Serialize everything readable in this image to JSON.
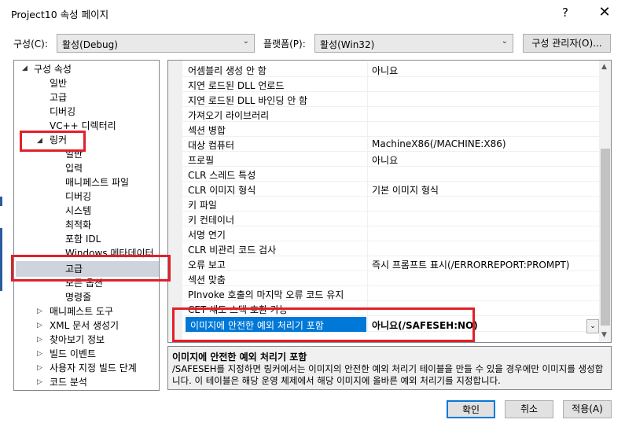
{
  "window": {
    "title": "Project10 속성 페이지",
    "help": "?",
    "close": "✕"
  },
  "toolbar": {
    "config_label": "구성(C):",
    "config_value": "활성(Debug)",
    "platform_label": "플랫폼(P):",
    "platform_value": "활성(Win32)",
    "config_manager": "구성 관리자(O)..."
  },
  "tree": {
    "items": [
      {
        "label": "구성 속성",
        "expanded": true
      },
      {
        "label": "일반"
      },
      {
        "label": "고급"
      },
      {
        "label": "디버깅"
      },
      {
        "label": "VC++ 디렉터리"
      },
      {
        "label": "링커",
        "expanded": true
      },
      {
        "label": "일반"
      },
      {
        "label": "입력"
      },
      {
        "label": "매니페스트 파일"
      },
      {
        "label": "디버깅"
      },
      {
        "label": "시스템"
      },
      {
        "label": "최적화"
      },
      {
        "label": "포함 IDL"
      },
      {
        "label": "Windows 메타데이터"
      },
      {
        "label": "고급",
        "selected": true
      },
      {
        "label": "모든 옵션"
      },
      {
        "label": "명령줄"
      },
      {
        "label": "매니페스트 도구",
        "expanded": false
      },
      {
        "label": "XML 문서 생성기",
        "expanded": false
      },
      {
        "label": "찾아보기 정보",
        "expanded": false
      },
      {
        "label": "빌드 이벤트",
        "expanded": false
      },
      {
        "label": "사용자 지정 빌드 단계",
        "expanded": false
      },
      {
        "label": "코드 분석",
        "expanded": false
      }
    ]
  },
  "grid": {
    "rows": [
      {
        "name": "어셈블리 생성 안 함",
        "value": "아니요"
      },
      {
        "name": "지연 로드된 DLL 언로드",
        "value": ""
      },
      {
        "name": "지연 로드된 DLL 바인딩 안 함",
        "value": ""
      },
      {
        "name": "가져오기 라이브러리",
        "value": ""
      },
      {
        "name": "섹션 병합",
        "value": ""
      },
      {
        "name": "대상 컴퓨터",
        "value": "MachineX86(/MACHINE:X86)"
      },
      {
        "name": "프로필",
        "value": "아니요"
      },
      {
        "name": "CLR 스레드 특성",
        "value": ""
      },
      {
        "name": "CLR 이미지 형식",
        "value": "기본 이미지 형식"
      },
      {
        "name": "키 파일",
        "value": ""
      },
      {
        "name": "키 컨테이너",
        "value": ""
      },
      {
        "name": "서명 연기",
        "value": ""
      },
      {
        "name": "CLR 비관리 코드 검사",
        "value": ""
      },
      {
        "name": "오류 보고",
        "value": "즉시 프롬프트 표시(/ERRORREPORT:PROMPT)"
      },
      {
        "name": "섹션 맞춤",
        "value": ""
      },
      {
        "name": "PInvoke 호출의 마지막 오류 코드 유지",
        "value": ""
      },
      {
        "name": "CET 섀도 스택 호환 가능",
        "value": ""
      },
      {
        "name": "이미지에 안전한 예외 처리기 포함",
        "value": "아니요(/SAFESEH:NO)",
        "selected": true
      }
    ]
  },
  "description": {
    "title": "이미지에 안전한 예외 처리기 포함",
    "body": "/SAFESEH를 지정하면 링커에서는 이미지의 안전한 예외 처리기 테이블을 만들 수 있을 경우에만 이미지를 생성합니다. 이 테이블은 해당 운영 체제에서 해당 이미지에 올바른 예외 처리기를 지정합니다."
  },
  "buttons": {
    "ok": "확인",
    "cancel": "취소",
    "apply": "적용(A)"
  },
  "colors": {
    "highlight": "#0078d7",
    "annotation_red": "#e0202a",
    "tree_selection": "#cfd4dc"
  }
}
